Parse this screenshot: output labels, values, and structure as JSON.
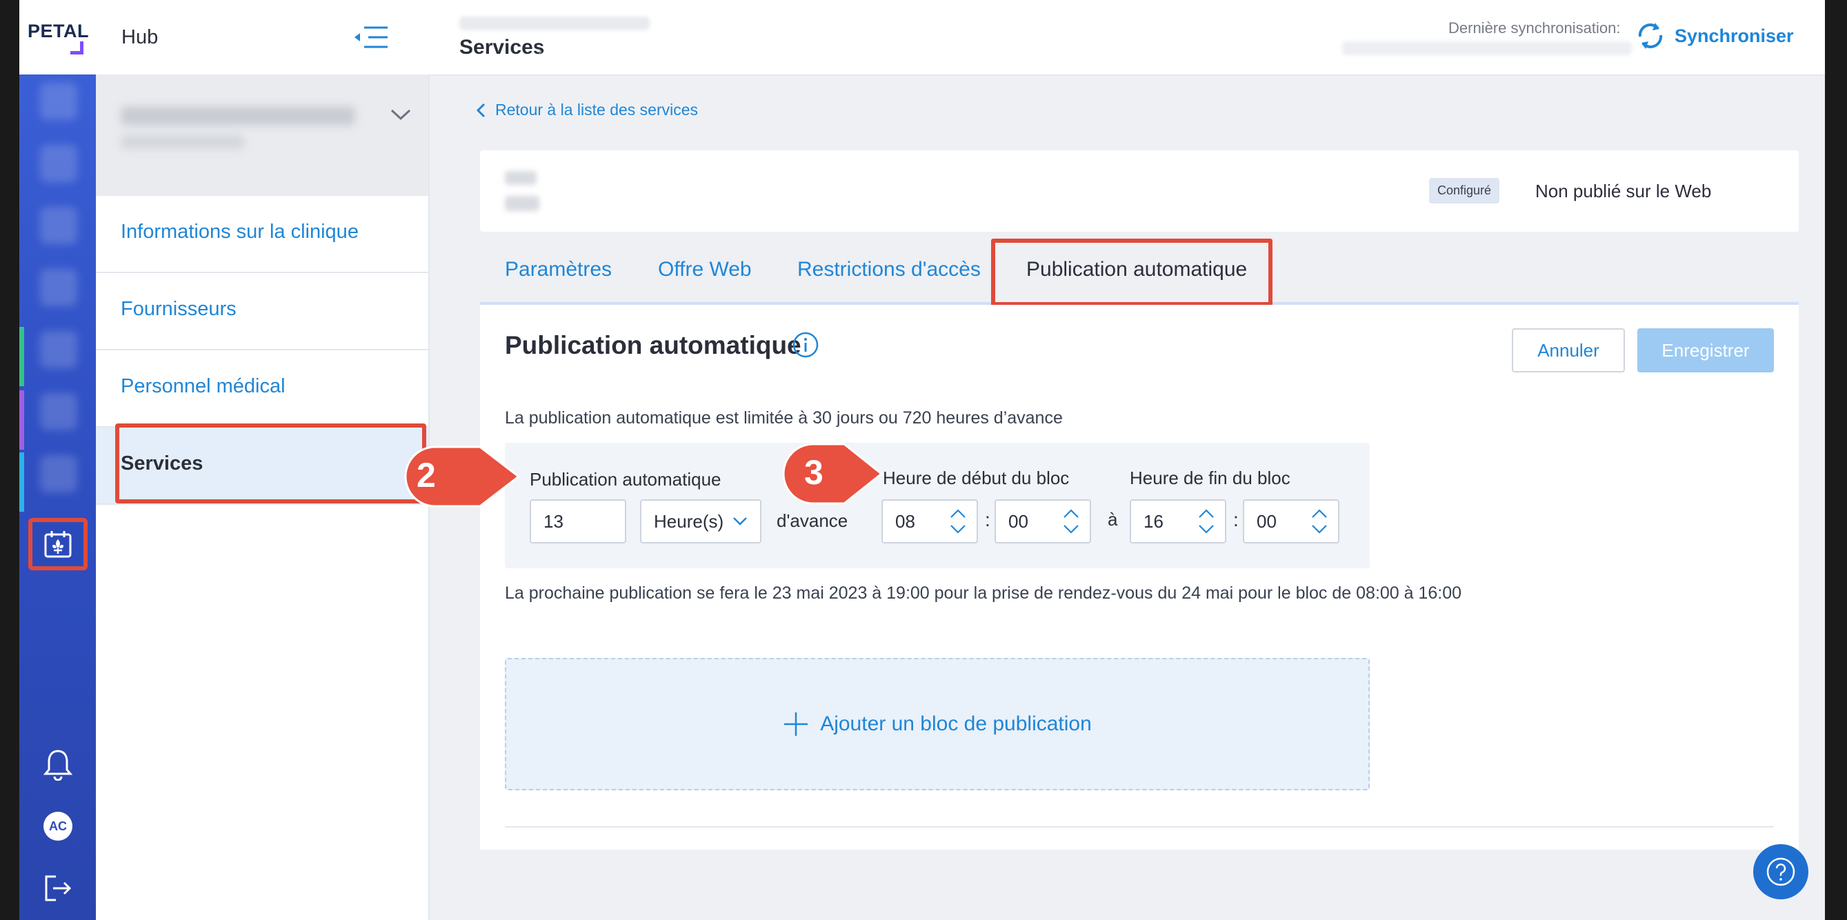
{
  "app": {
    "logo_text": "PETAL",
    "hub_label": "Hub",
    "page_title": "Services",
    "page_title_chevron": "›"
  },
  "sync": {
    "label": "Dernière synchronisation:",
    "button_label": "Synchroniser"
  },
  "sidebar": {
    "items": [
      {
        "label": "Informations sur la clinique"
      },
      {
        "label": "Fournisseurs"
      },
      {
        "label": "Personnel médical"
      },
      {
        "label": "Services"
      }
    ],
    "active_index": 3
  },
  "user": {
    "initials": "AC"
  },
  "back_link": "Retour à la liste des services",
  "service": {
    "status_badge": "Configuré",
    "web_status": "Non publié sur le Web"
  },
  "tabs": [
    {
      "label": "Paramètres"
    },
    {
      "label": "Offre Web"
    },
    {
      "label": "Restrictions d'accès"
    },
    {
      "label": "Publication automatique"
    }
  ],
  "active_tab": 3,
  "panel": {
    "title": "Publication automatique",
    "cancel_label": "Annuler",
    "save_label": "Enregistrer",
    "limit_text": "La publication automatique est limitée à 30 jours ou 720 heures d’avance",
    "auto_pub_label": "Publication automatique",
    "advance_value": "13",
    "unit_value": "Heure(s)",
    "advance_suffix": "d'avance",
    "start_label": "Heure de début du bloc",
    "start_hour": "08",
    "start_minute": "00",
    "end_label": "Heure de fin du bloc",
    "end_hour": "16",
    "end_minute": "00",
    "time_sep": ":",
    "range_sep": "à",
    "next_text": "La prochaine publication se fera le 23 mai 2023 à 19:00 pour la prise de rendez-vous du 24 mai pour le bloc de 08:00 à 16:00",
    "add_block_label": "Ajouter un bloc de publication"
  },
  "callouts": [
    {
      "number": "2"
    },
    {
      "number": "3"
    }
  ],
  "colors": {
    "accent": "#1f86d6",
    "highlight": "#e04a3a",
    "rail": "#2f4fc2",
    "save_disabled": "#9ccaf2"
  },
  "icons": {
    "collapse": "collapse-menu-icon",
    "sync": "sync-icon",
    "info": "info-icon",
    "calendar": "calendar-fleur-icon",
    "bell": "bell-icon",
    "logout": "logout-icon",
    "help": "help-icon",
    "plus": "plus-icon"
  }
}
